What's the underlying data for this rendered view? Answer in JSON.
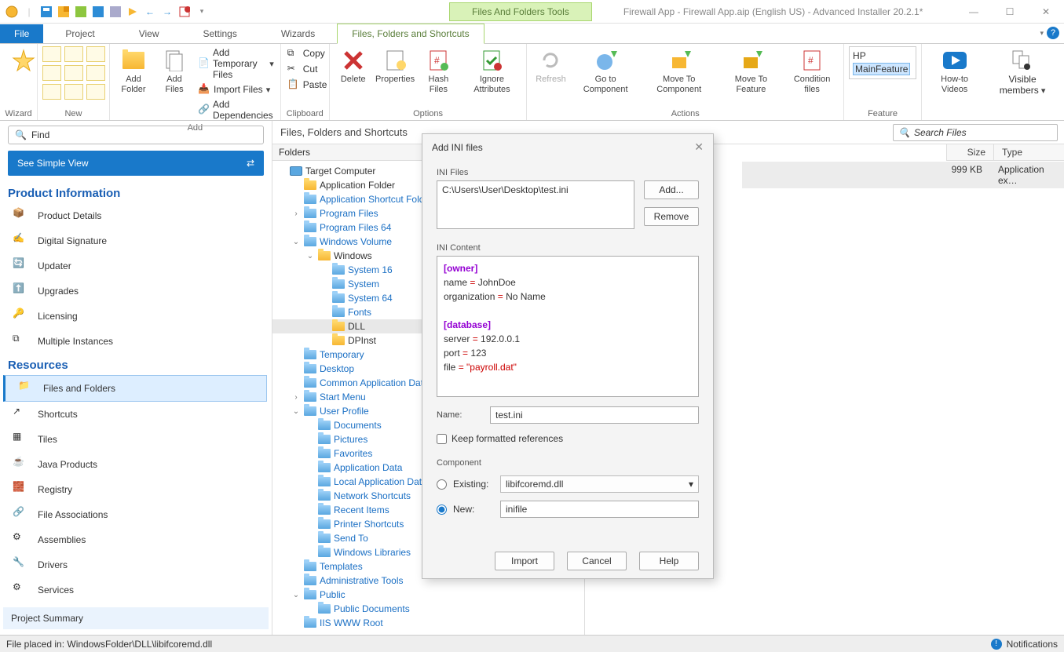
{
  "window": {
    "context_tab": "Files And Folders Tools",
    "title": "Firewall App - Firewall App.aip (English US) - Advanced Installer 20.2.1*"
  },
  "menubar": {
    "file": "File",
    "items": [
      "Project",
      "View",
      "Settings",
      "Wizards"
    ],
    "contextual": "Files, Folders and Shortcuts"
  },
  "ribbon": {
    "wizard": "Wizard",
    "new": "New",
    "add": {
      "label": "Add",
      "add_folder": "Add Folder",
      "add_files": "Add Files",
      "temp": "Add Temporary Files",
      "import": "Import Files",
      "deps": "Add Dependencies"
    },
    "clipboard": {
      "label": "Clipboard",
      "copy": "Copy",
      "cut": "Cut",
      "paste": "Paste"
    },
    "options": {
      "label": "Options",
      "delete": "Delete",
      "properties": "Properties",
      "hash": "Hash Files",
      "ignore": "Ignore Attributes"
    },
    "actions": {
      "label": "Actions",
      "refresh": "Refresh",
      "gotocomp": "Go to Component",
      "movecomp": "Move To Component",
      "movefeat": "Move To Feature",
      "cond": "Condition files"
    },
    "feature": {
      "label": "Feature",
      "hp": "HP",
      "main": "MainFeature"
    },
    "howto": "How-to Videos",
    "visible": "Visible members"
  },
  "left": {
    "find_ph": "Find",
    "simple": "See Simple View",
    "product_info": "Product Information",
    "pi_items": [
      "Product Details",
      "Digital Signature",
      "Updater",
      "Upgrades",
      "Licensing",
      "Multiple Instances"
    ],
    "resources": "Resources",
    "res_items": [
      "Files and Folders",
      "Shortcuts",
      "Tiles",
      "Java Products",
      "Registry",
      "File Associations",
      "Assemblies",
      "Drivers",
      "Services"
    ],
    "summary": "Project Summary"
  },
  "page": {
    "title": "Files, Folders and Shortcuts",
    "search_ph": "Search Files",
    "folders_head": "Folders",
    "list_cols": {
      "size": "Size",
      "type": "Type"
    },
    "list_row": {
      "size": "999 KB",
      "type": "Application ex…"
    }
  },
  "tree": [
    {
      "d": 0,
      "exp": "",
      "ic": "pc",
      "name": "Target Computer"
    },
    {
      "d": 1,
      "exp": "",
      "ic": "f",
      "name": "Application Folder"
    },
    {
      "d": 1,
      "exp": "",
      "ic": "b",
      "name": "Application Shortcut Folder"
    },
    {
      "d": 1,
      "exp": "›",
      "ic": "b",
      "name": "Program Files"
    },
    {
      "d": 1,
      "exp": "",
      "ic": "b",
      "name": "Program Files 64"
    },
    {
      "d": 1,
      "exp": "⌄",
      "ic": "b",
      "name": "Windows Volume"
    },
    {
      "d": 2,
      "exp": "⌄",
      "ic": "f",
      "name": "Windows"
    },
    {
      "d": 3,
      "exp": "",
      "ic": "b",
      "name": "System 16"
    },
    {
      "d": 3,
      "exp": "",
      "ic": "b",
      "name": "System"
    },
    {
      "d": 3,
      "exp": "",
      "ic": "b",
      "name": "System 64"
    },
    {
      "d": 3,
      "exp": "",
      "ic": "b",
      "name": "Fonts"
    },
    {
      "d": 3,
      "exp": "",
      "ic": "f",
      "name": "DLL",
      "sel": true
    },
    {
      "d": 3,
      "exp": "",
      "ic": "f",
      "name": "DPInst"
    },
    {
      "d": 1,
      "exp": "",
      "ic": "b",
      "name": "Temporary"
    },
    {
      "d": 1,
      "exp": "",
      "ic": "b",
      "name": "Desktop"
    },
    {
      "d": 1,
      "exp": "",
      "ic": "b",
      "name": "Common Application Data"
    },
    {
      "d": 1,
      "exp": "›",
      "ic": "b",
      "name": "Start Menu"
    },
    {
      "d": 1,
      "exp": "⌄",
      "ic": "b",
      "name": "User Profile"
    },
    {
      "d": 2,
      "exp": "",
      "ic": "b",
      "name": "Documents"
    },
    {
      "d": 2,
      "exp": "",
      "ic": "b",
      "name": "Pictures"
    },
    {
      "d": 2,
      "exp": "",
      "ic": "b",
      "name": "Favorites"
    },
    {
      "d": 2,
      "exp": "",
      "ic": "b",
      "name": "Application Data"
    },
    {
      "d": 2,
      "exp": "",
      "ic": "b",
      "name": "Local Application Data"
    },
    {
      "d": 2,
      "exp": "",
      "ic": "b",
      "name": "Network Shortcuts"
    },
    {
      "d": 2,
      "exp": "",
      "ic": "b",
      "name": "Recent Items"
    },
    {
      "d": 2,
      "exp": "",
      "ic": "b",
      "name": "Printer Shortcuts"
    },
    {
      "d": 2,
      "exp": "",
      "ic": "b",
      "name": "Send To"
    },
    {
      "d": 2,
      "exp": "",
      "ic": "b",
      "name": "Windows Libraries"
    },
    {
      "d": 1,
      "exp": "",
      "ic": "b",
      "name": "Templates"
    },
    {
      "d": 1,
      "exp": "",
      "ic": "b",
      "name": "Administrative Tools"
    },
    {
      "d": 1,
      "exp": "⌄",
      "ic": "b",
      "name": "Public"
    },
    {
      "d": 2,
      "exp": "",
      "ic": "b",
      "name": "Public Documents"
    },
    {
      "d": 1,
      "exp": "",
      "ic": "b",
      "name": "IIS WWW Root"
    }
  ],
  "dialog": {
    "title": "Add INI files",
    "ini_files_label": "INI Files",
    "file_path": "C:\\Users\\User\\Desktop\\test.ini",
    "add": "Add...",
    "remove": "Remove",
    "ini_content_label": "INI Content",
    "ini": {
      "s1": "[owner]",
      "l1a": "name",
      "l1b": "JohnDoe",
      "l2a": "organization",
      "l2b": "No Name",
      "s2": "[database]",
      "l3a": "server",
      "l3b": "192.0.0.1",
      "l4a": "port",
      "l4b": "123",
      "l5a": "file",
      "l5b": "\"payroll.dat\""
    },
    "name_label": "Name:",
    "name_value": "test.ini",
    "keep_refs": "Keep formatted references",
    "component_label": "Component",
    "existing": "Existing:",
    "existing_val": "libifcoremd.dll",
    "new": "New:",
    "new_val": "inifile",
    "import": "Import",
    "cancel": "Cancel",
    "help": "Help"
  },
  "status": {
    "text": "File placed in: WindowsFolder\\DLL\\libifcoremd.dll",
    "notif": "Notifications"
  }
}
